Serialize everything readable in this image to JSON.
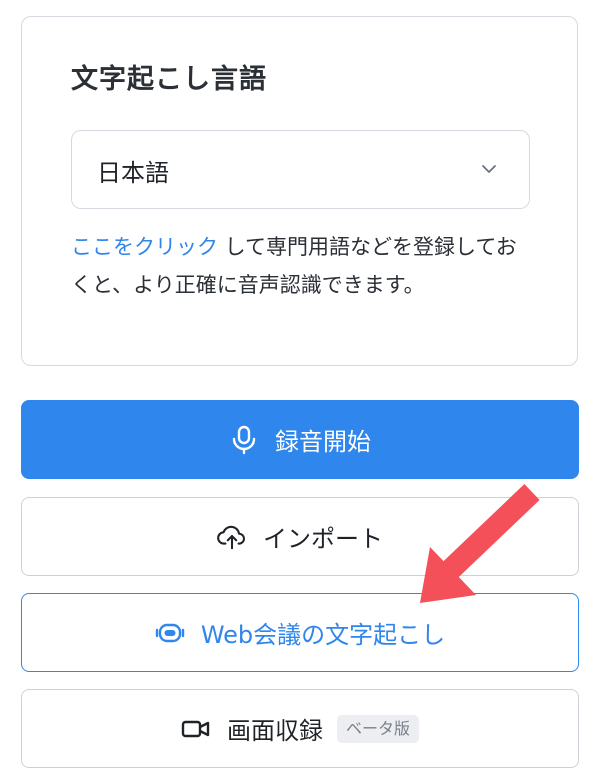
{
  "language_card": {
    "title": "文字起こし言語",
    "selected_language": "日本語",
    "help_link_text": "ここをクリック",
    "help_text": " して専門用語などを登録しておくと、より正確に音声認識できます。"
  },
  "buttons": {
    "record_label": "録音開始",
    "import_label": "インポート",
    "web_meeting_label": "Web会議の文字起こし",
    "screen_record_label": "画面収録",
    "beta_badge": "ベータ版"
  },
  "icons": {
    "select": "chevron-down-icon",
    "record": "microphone-icon",
    "import": "cloud-upload-icon",
    "web_meeting": "bot-icon",
    "screen_record": "video-camera-icon",
    "annotation": "arrow-annotation"
  },
  "colors": {
    "accent": "#2f86ec",
    "annotation_arrow": "#f4505a",
    "border": "#d6dae0",
    "badge_bg": "#eceef1"
  }
}
